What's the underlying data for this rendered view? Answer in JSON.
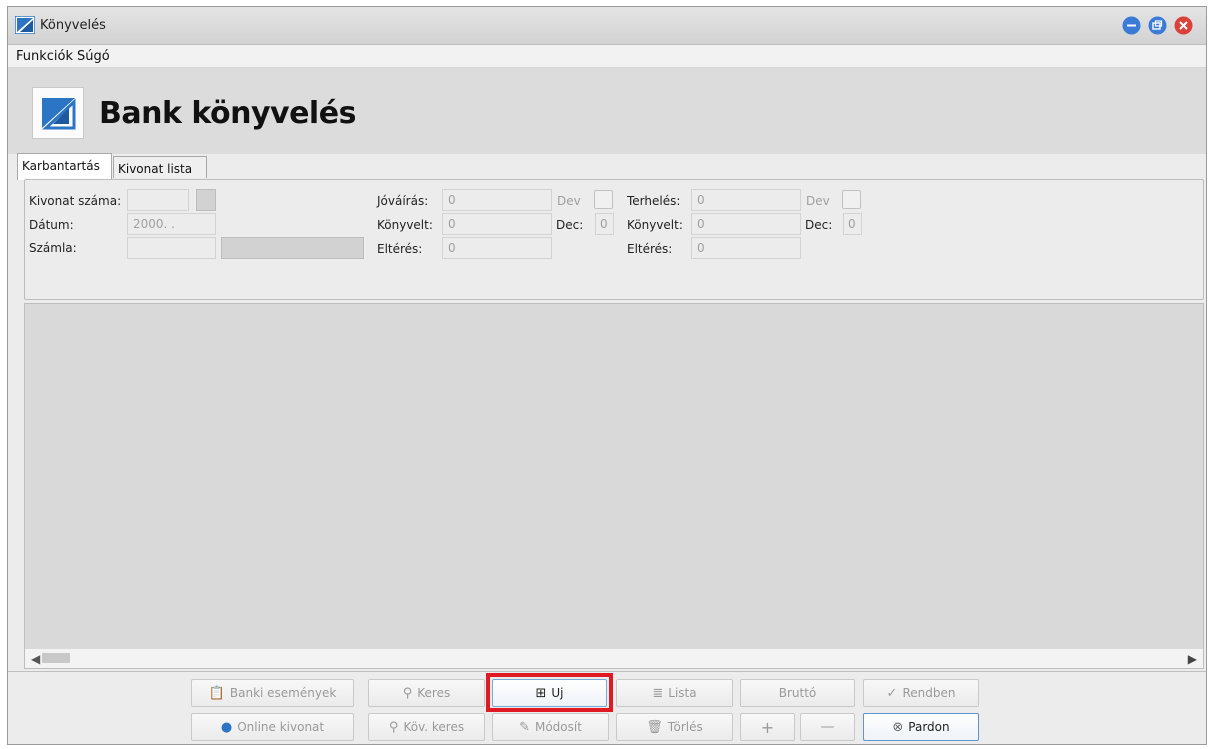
{
  "window": {
    "title": "Könyvelés",
    "controls": [
      "minimize-icon",
      "restore-icon",
      "close-icon"
    ],
    "colors": {
      "minimize": "#3a7bd5",
      "restore": "#3a7bd5",
      "close": "#d9413a"
    }
  },
  "menu": {
    "items": [
      "Funkciók",
      "Súgó"
    ]
  },
  "header": {
    "title": "Bank könyvelés",
    "logo_icon": "bank-logo-icon"
  },
  "tabs": [
    {
      "label": "Karbantartás",
      "active": true
    },
    {
      "label": "Kivonat lista",
      "active": false
    }
  ],
  "form": {
    "kivonat_szama_label": "Kivonat száma:",
    "kivonat_szama_value": "",
    "datum_label": "Dátum:",
    "datum_value": "2000. .",
    "szamla_label": "Számla:",
    "szamla_value": "",
    "szamla_name_value": "",
    "jovairas_label": "Jóváírás:",
    "jovairas_value": "0",
    "jovairas_dev_label": "Dev",
    "konyvelt1_label": "Könyvelt:",
    "konyvelt1_value": "0",
    "dec1_label": "Dec:",
    "dec1_value": "0",
    "elteres1_label": "Eltérés:",
    "elteres1_value": "0",
    "terheles_label": "Terhelés:",
    "terheles_value": "0",
    "terheles_dev_label": "Dev",
    "konyvelt2_label": "Könyvelt:",
    "konyvelt2_value": "0",
    "dec2_label": "Dec:",
    "dec2_value": "0",
    "elteres2_label": "Eltérés:",
    "elteres2_value": "0"
  },
  "buttons": {
    "banki_esemenyek": {
      "label": "Banki események",
      "icon": "clipboard-icon",
      "enabled": false
    },
    "online_kivonat": {
      "label": "Online kivonat",
      "icon": "globe-icon",
      "enabled": false
    },
    "keres": {
      "label": "Keres",
      "icon": "search-icon",
      "enabled": false
    },
    "kov_keres": {
      "label": "Köv. keres",
      "icon": "search-icon",
      "enabled": false
    },
    "uj": {
      "label": "Uj",
      "icon": "add-icon",
      "enabled": true,
      "highlighted": true,
      "highlight_color": "#e01a22"
    },
    "modosit": {
      "label": "Módosít",
      "icon": "edit-icon",
      "enabled": false
    },
    "lista": {
      "label": "Lista",
      "icon": "list-icon",
      "enabled": false
    },
    "torles": {
      "label": "Törlés",
      "icon": "trash-icon",
      "enabled": false
    },
    "brutto": {
      "label": "Bruttó",
      "enabled": false
    },
    "plus": {
      "label": "+",
      "enabled": false
    },
    "minus": {
      "label": "—",
      "enabled": false
    },
    "rendben": {
      "label": "Rendben",
      "icon": "check-circle-icon",
      "enabled": false
    },
    "pardon": {
      "label": "Pardon",
      "icon": "cancel-circle-icon",
      "enabled": true
    }
  }
}
